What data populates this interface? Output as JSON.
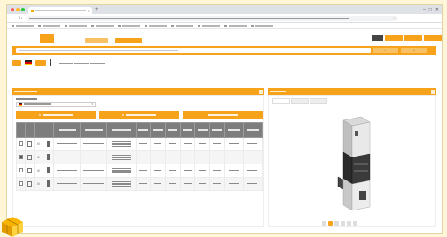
{
  "browser": {
    "tab_title": "",
    "url": "",
    "bookmarks": [
      "",
      "",
      "",
      "",
      "",
      "",
      "",
      "",
      "",
      "",
      "",
      ""
    ]
  },
  "app": {
    "logo_text": "",
    "header_tabs": [
      "",
      ""
    ],
    "search_placeholder": "",
    "search_button": ""
  },
  "product": {
    "title": "",
    "breadcrumb": [
      "",
      "",
      ""
    ]
  },
  "left_panel": {
    "title": "",
    "filter_label": "",
    "filter_value": "",
    "buttons": [
      "",
      "",
      ""
    ],
    "table": {
      "columns": [
        "",
        "",
        "",
        "",
        "",
        "",
        "",
        "",
        "",
        "",
        "",
        "",
        "",
        "",
        ""
      ],
      "rows": [
        {
          "selected": false,
          "cells": [
            "",
            "",
            "",
            "",
            "",
            "",
            "",
            "",
            "",
            "",
            ""
          ]
        },
        {
          "selected": true,
          "cells": [
            "",
            "",
            "",
            "",
            "",
            "",
            "",
            "",
            "",
            "",
            ""
          ]
        },
        {
          "selected": false,
          "cells": [
            "",
            "",
            "",
            "",
            "",
            "",
            "",
            "",
            "",
            "",
            ""
          ]
        },
        {
          "selected": false,
          "cells": [
            "",
            "",
            "",
            "",
            "",
            "",
            "",
            "",
            "",
            "",
            ""
          ]
        }
      ]
    }
  },
  "right_panel": {
    "title": "",
    "view_tabs": [
      "",
      "",
      ""
    ]
  },
  "colors": {
    "accent": "#f7a21b",
    "accent_light": "#f9c165",
    "table_header": "#7d7d7d",
    "background": "#fff6d8"
  },
  "icons": [
    "back-icon",
    "forward-icon",
    "reload-icon",
    "star-icon",
    "search-icon",
    "cart-icon",
    "gear-icon",
    "close-icon",
    "minimize-icon",
    "maximize-icon"
  ]
}
